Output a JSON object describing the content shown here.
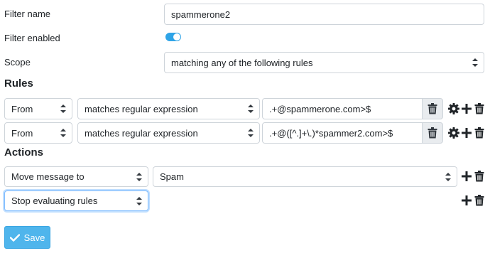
{
  "labels": {
    "filter_name": "Filter name",
    "filter_enabled": "Filter enabled",
    "scope": "Scope",
    "rules": "Rules",
    "actions": "Actions"
  },
  "filter": {
    "name_value": "spammerone2",
    "enabled": true,
    "scope_value": "matching any of the following rules"
  },
  "rules": [
    {
      "header": "From",
      "operator": "matches regular expression",
      "value": ".+@spammerone.com>$"
    },
    {
      "header": "From",
      "operator": "matches regular expression",
      "value": ".+@([^.]+\\.)*spammer2.com>$"
    }
  ],
  "actions": [
    {
      "type": "Move message to",
      "target": "Spam"
    },
    {
      "type": "Stop evaluating rules"
    }
  ],
  "save_label": "Save",
  "colors": {
    "accent": "#2fa4e7",
    "save_button": "#4fb5ec"
  },
  "icons": [
    "trash-icon",
    "gear-icon",
    "plus-icon",
    "check-icon",
    "select-caret-icon"
  ]
}
